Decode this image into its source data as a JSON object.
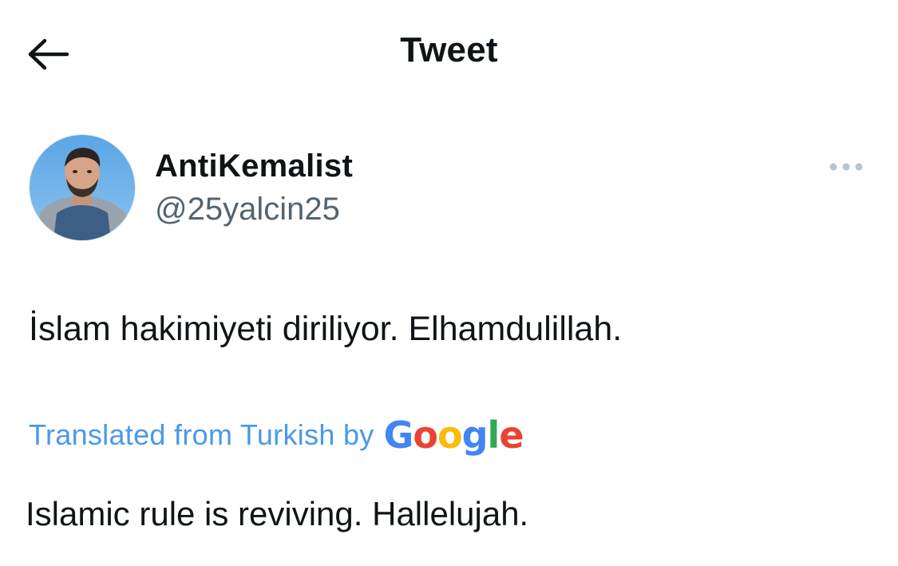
{
  "header": {
    "title": "Tweet",
    "back_icon": "arrow-left-icon"
  },
  "tweet": {
    "author": {
      "display_name": "AntiKemalist",
      "handle": "@25yalcin25",
      "avatar": "profile-photo"
    },
    "more_icon": "more-horizontal-icon",
    "text": "İslam hakimiyeti diriliyor. Elhamdulillah.",
    "translation": {
      "label": "Translated from Turkish by",
      "provider_logo": {
        "letters": [
          "G",
          "o",
          "o",
          "g",
          "l",
          "e"
        ],
        "colors": [
          "#4285F4",
          "#EA4335",
          "#FBBC05",
          "#4285F4",
          "#34A853",
          "#EA4335"
        ]
      },
      "text": "Islamic rule is reviving. Hallelujah."
    }
  },
  "colors": {
    "text": "#0f1419",
    "secondary": "#536471",
    "link": "#4a99e9"
  }
}
